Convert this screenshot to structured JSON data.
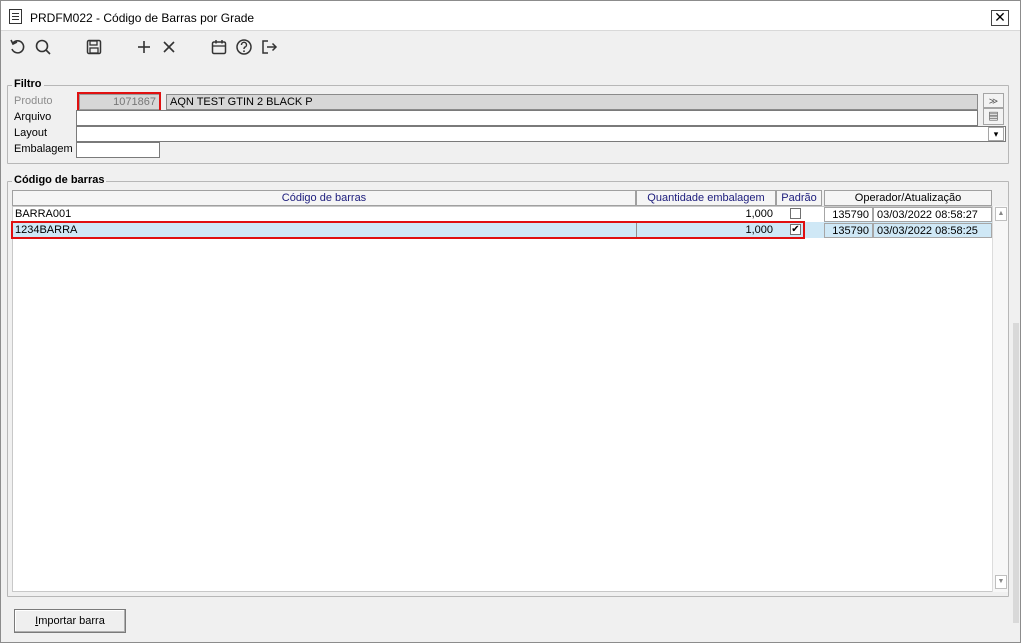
{
  "window": {
    "title": "PRDFM022 - Código de Barras por Grade",
    "close_glyph": "✕"
  },
  "toolbar": {
    "icons": [
      "undo-icon",
      "search-icon",
      "save-icon",
      "add-icon",
      "delete-icon",
      "calendar-icon",
      "help-icon",
      "exit-icon"
    ]
  },
  "filtro": {
    "group_label": "Filtro",
    "produto_label": "Produto",
    "produto_code": "1071867",
    "produto_desc": "AQN TEST GTIN 2 BLACK P",
    "arquivo_label": "Arquivo",
    "arquivo_value": "",
    "layout_label": "Layout",
    "layout_value": "",
    "embalagem_label": "Embalagem",
    "embalagem_value": ""
  },
  "barras": {
    "group_label": "Código de barras",
    "columns": [
      "Código de barras",
      "Quantidade embalagem",
      "Padrão",
      "Operador/Atualização"
    ],
    "rows": [
      {
        "codigo": "BARRA001",
        "quantidade": "1,000",
        "padrao": false,
        "operador": "135790",
        "atualizacao": "03/03/2022 08:58:27"
      },
      {
        "codigo": "1234BARRA",
        "quantidade": "1,000",
        "padrao": true,
        "operador": "135790",
        "atualizacao": "03/03/2022 08:58:25"
      }
    ]
  },
  "buttons": {
    "importar_prefix": "I",
    "importar_rest": "mportar barra"
  },
  "colors": {
    "highlight": "#e01010",
    "selected_row": "#cfe8f6"
  }
}
